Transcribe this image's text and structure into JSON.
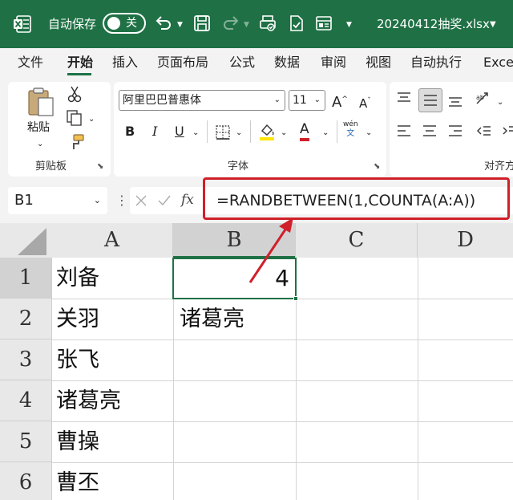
{
  "titlebar": {
    "autosave_label": "自动保存",
    "autosave_state": "关",
    "filename": "20240412抽奖.xlsx",
    "icons": [
      "excel-logo-icon",
      "undo-icon",
      "save-icon",
      "redo-icon",
      "print-preview-icon",
      "doc-check-icon",
      "form-icon"
    ]
  },
  "menu": {
    "tabs": [
      "文件",
      "开始",
      "插入",
      "页面布局",
      "公式",
      "数据",
      "审阅",
      "视图",
      "自动执行",
      "Exce"
    ],
    "active": "开始"
  },
  "ribbon": {
    "clipboard": {
      "paste_label": "粘贴",
      "group_label": "剪贴板"
    },
    "font": {
      "font_name": "阿里巴巴普惠体",
      "font_size": "11",
      "bold": "B",
      "italic": "I",
      "underline": "U",
      "font_color_glyph": "A",
      "grow": "A",
      "shrink": "A",
      "pinyin_top": "wén",
      "pinyin_bottom": "文",
      "group_label": "字体"
    },
    "alignment": {
      "group_label": "对齐方"
    },
    "colors": {
      "highlight_yellow": "#ffe600",
      "font_red": "#d0202a",
      "accent_green": "#1f7145"
    }
  },
  "formula_bar": {
    "name_box": "B1",
    "fx": "fx",
    "formula": "=RANDBETWEEN(1,COUNTA(A:A))"
  },
  "sheet": {
    "columns": [
      "A",
      "B",
      "C",
      "D"
    ],
    "selected_column": "B",
    "rows": [
      "1",
      "2",
      "3",
      "4",
      "5",
      "6"
    ],
    "selected_row": "1",
    "column_a": [
      "刘备",
      "关羽",
      "张飞",
      "诸葛亮",
      "曹操",
      "曹丕"
    ],
    "b1": "4",
    "b2": "诸葛亮"
  },
  "annotation": {
    "box_color": "#d0202a"
  }
}
